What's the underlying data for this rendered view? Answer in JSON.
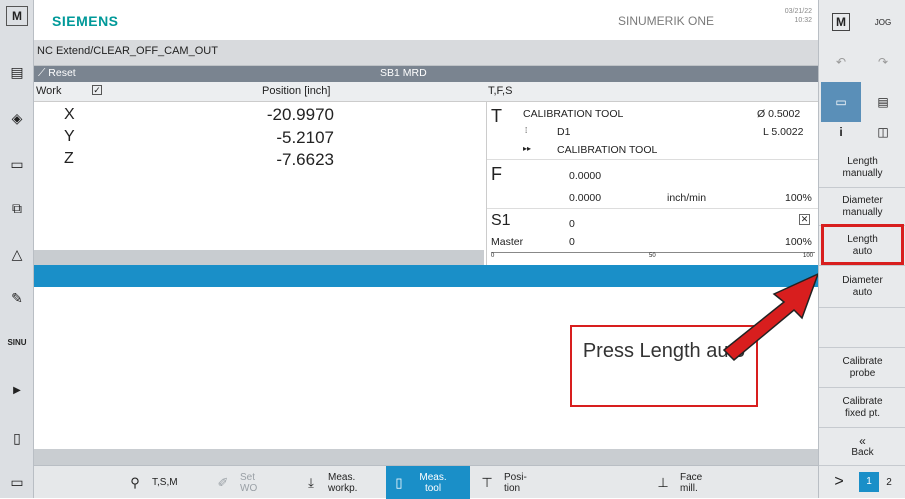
{
  "brand": "SIEMENS",
  "product": "SINUMERIK ONE",
  "date": "03/21/22",
  "time": "10:32",
  "program_path": "NC Extend/CLEAR_OFF_CAM_OUT",
  "status": {
    "reset": "Reset",
    "channel": "SB1 MRD"
  },
  "header": {
    "work": "Work",
    "position": "Position [inch]",
    "tfs": "T,F,S"
  },
  "axes": [
    {
      "name": "X",
      "value": "-20.9970"
    },
    {
      "name": "Y",
      "value": "-5.2107"
    },
    {
      "name": "Z",
      "value": "-7.6623"
    }
  ],
  "tool": {
    "letter": "T",
    "name": "CALIBRATION TOOL",
    "diameter": "Ø 0.5002",
    "d_label": "D1",
    "length": "L 5.0022",
    "next_name": "CALIBRATION TOOL"
  },
  "feed": {
    "letter": "F",
    "value1": "0.0000",
    "value2": "0.0000",
    "unit": "inch/min",
    "override": "100%"
  },
  "spindle": {
    "label": "S1",
    "value": "0",
    "master": "Master",
    "master_value": "0",
    "override": "100%",
    "scale": [
      "0",
      "50",
      "100"
    ]
  },
  "right_softkeys": [
    "Length manually",
    "Diameter manually",
    "Length auto",
    "Diameter auto",
    "",
    "Calibrate probe",
    "Calibrate fixed pt.",
    "Back"
  ],
  "bottom_softkeys": [
    {
      "label": "T,S,M",
      "icon": "tsm-icon"
    },
    {
      "label": "Set WO",
      "icon": "set-wo-icon"
    },
    {
      "label": "Meas. workp.",
      "icon": "meas-workpiece-icon"
    },
    {
      "label": "Meas. tool",
      "icon": "meas-tool-icon"
    },
    {
      "label": "Posi- tion",
      "icon": "position-icon"
    },
    {
      "label": "Face mill.",
      "icon": "face-mill-icon"
    }
  ],
  "pager": {
    "next": ">",
    "page1": "1",
    "page2": "2"
  },
  "annotation": "Press Length auto",
  "colors": {
    "accent_blue": "#1a8fc8",
    "highlight_red": "#d81e1e",
    "brand_teal": "#009999"
  }
}
